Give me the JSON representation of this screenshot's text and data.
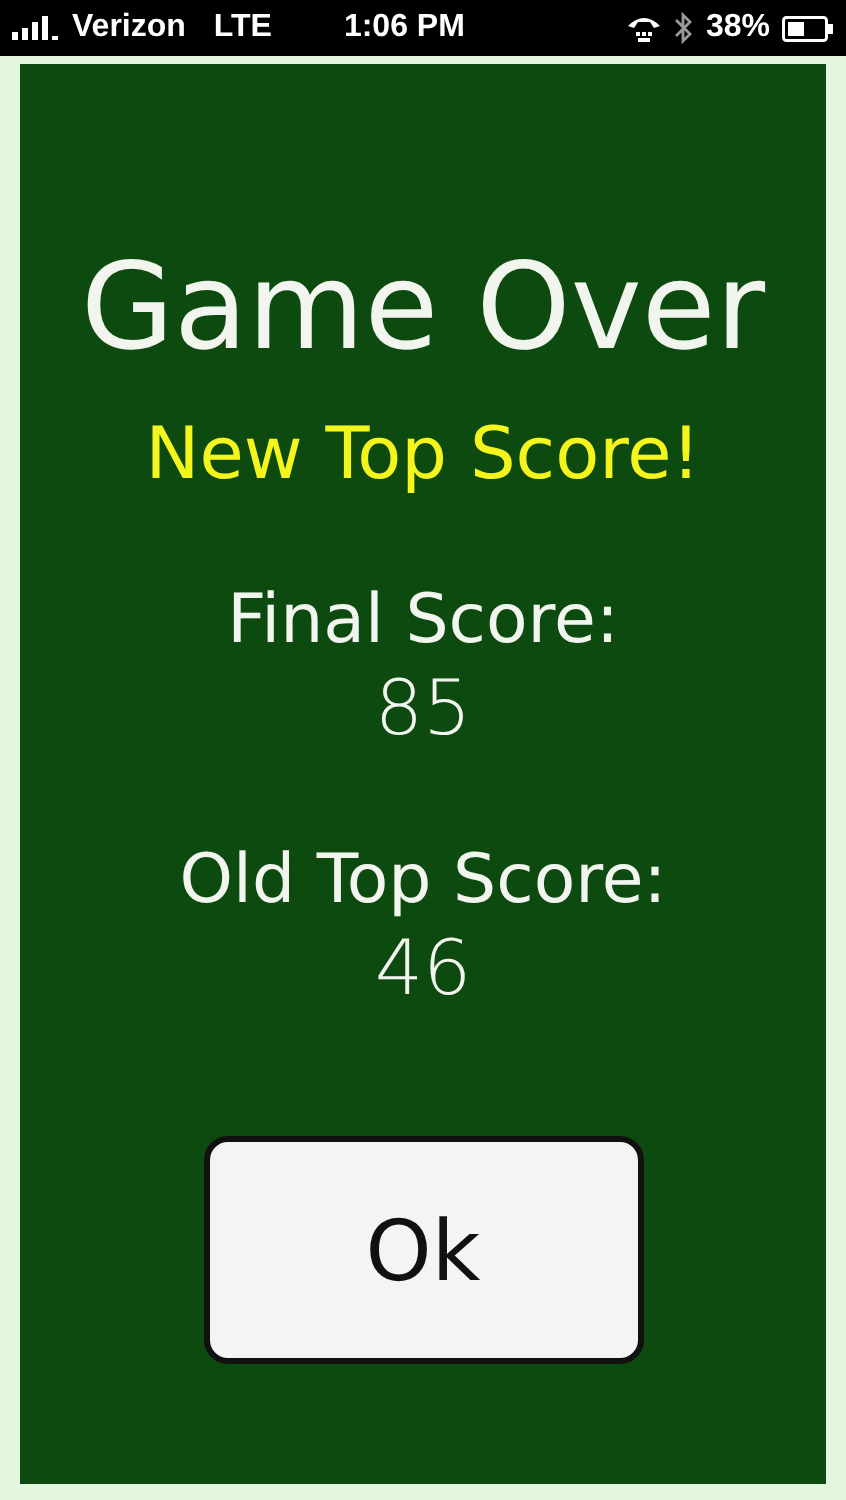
{
  "status_bar": {
    "carrier": "Verizon",
    "network": "LTE",
    "time": "1:06 PM",
    "battery": "38%"
  },
  "dialog": {
    "title": "Game Over",
    "subtitle": "New Top Score!",
    "results": [
      {
        "label": "Final Score:",
        "value": "85"
      },
      {
        "label": "Old Top Score:",
        "value": "46"
      }
    ],
    "button": "Ok"
  }
}
